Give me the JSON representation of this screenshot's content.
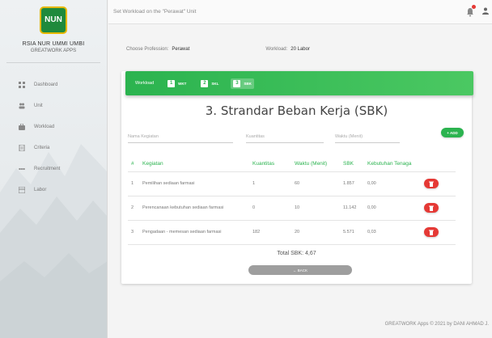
{
  "app": {
    "logo_text": "NUN",
    "brand_title": "RSIA NUR UMMI UMBI",
    "brand_subtitle": "GREATWORK APPS"
  },
  "sidebar": {
    "items": [
      {
        "label": "Dashboard",
        "icon": "dashboard-icon"
      },
      {
        "label": "Unit",
        "icon": "unit-icon"
      },
      {
        "label": "Workload",
        "icon": "workload-icon"
      },
      {
        "label": "Criteria",
        "icon": "criteria-icon"
      },
      {
        "label": "Recruitment",
        "icon": "recruitment-icon"
      },
      {
        "label": "Labor",
        "icon": "labor-icon"
      }
    ]
  },
  "topbar": {
    "title": "Set Workload on the \"Perawat\" Unit"
  },
  "subheader": {
    "profession_label": "Choose Profession:",
    "profession_value": "Perawat",
    "workload_label": "Workload:",
    "workload_value": "20 Labor"
  },
  "wizard": {
    "label": "Workload",
    "steps": [
      {
        "num": "1",
        "label": "WKT"
      },
      {
        "num": "2",
        "label": "SKL"
      },
      {
        "num": "3",
        "label": "SBK"
      }
    ]
  },
  "card": {
    "title": "3. Strandar Beban Kerja (SBK)",
    "add_label": "+ ADD",
    "back_label": "← BACK",
    "total": "Total SBK: 4,67"
  },
  "form": {
    "kegiatan_placeholder": "Nama Kegiatan",
    "kuantitas_placeholder": "Kuantitas",
    "waktu_placeholder": "Waktu (Menit)"
  },
  "table": {
    "headers": [
      "#",
      "Kegiatan",
      "Kuantitas",
      "Waktu (Menit)",
      "SBK",
      "Kebutuhan Tenaga"
    ],
    "rows": [
      {
        "no": "1",
        "kegiatan": "Pemilihan sediaan farmasi",
        "kuantitas": "1",
        "waktu": "60",
        "sbk": "1.857",
        "kebutuhan": "0,00"
      },
      {
        "no": "2",
        "kegiatan": "Perencanaan kebutuhan sediaan farmasi",
        "kuantitas": "0",
        "waktu": "10",
        "sbk": "11.142",
        "kebutuhan": "0,00"
      },
      {
        "no": "3",
        "kegiatan": "Pengadaan - memesan sediaan farmasi",
        "kuantitas": "182",
        "waktu": "20",
        "sbk": "5.571",
        "kebutuhan": "0,03"
      }
    ]
  },
  "footer": {
    "text": "GREATWORK Apps © 2021 by DANI AHMAD J."
  },
  "colors": {
    "accent": "#2bb34f",
    "danger": "#e53935"
  }
}
